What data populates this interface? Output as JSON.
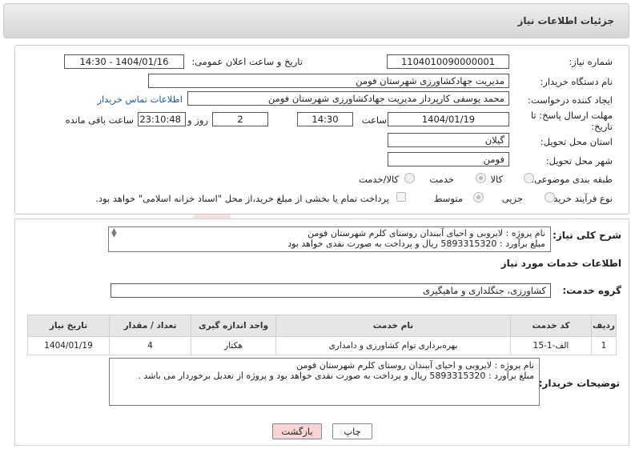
{
  "header": {
    "title": "جزئیات اطلاعات نیاز"
  },
  "form": {
    "need_number": {
      "label": "شماره نیاز:",
      "value": "1104010090000001"
    },
    "announce_datetime": {
      "label": "تاریخ و ساعت اعلان عمومی:",
      "value": "1404/01/16 - 14:30"
    },
    "buyer_org": {
      "label": "نام دستگاه خریدار:",
      "value": "مدیریت جهادکشاورزی شهرستان فومن"
    },
    "requester": {
      "label": "ایجاد کننده درخواست:",
      "value": "محمد یوسفی کارپرداز مدیریت جهادکشاورزی شهرستان فومن",
      "contact_link": "اطلاعات تماس خریدار"
    },
    "deadline": {
      "label": "مهلت ارسال پاسخ: تا تاریخ:",
      "date": "1404/01/19",
      "time_label": "ساعت",
      "time": "14:30",
      "days": "2",
      "days_label": "روز و",
      "remaining": "23:10:48",
      "remaining_label": "ساعت باقی مانده"
    },
    "province": {
      "label": "استان محل تحویل:",
      "value": "گیلان"
    },
    "city": {
      "label": "شهر محل تحویل:",
      "value": "فومن"
    },
    "category": {
      "label": "طبقه بندی موضوعی:",
      "options": [
        "کالا",
        "خدمت",
        "کالا/خدمت"
      ],
      "selected": "خدمت"
    },
    "process": {
      "label": "نوع فرآیند خرید :",
      "options": [
        "جزیی",
        "متوسط"
      ],
      "selected": "متوسط",
      "note": "پرداخت تمام یا بخشی از مبلغ خرید،از محل \"اسناد خزانه اسلامی\" خواهد بود."
    }
  },
  "summary": {
    "label": "شرح کلی نیاز:",
    "line1": "نام پروژه :     لایروبی و احیای آببندان روستای کلرم شهرستان فومن",
    "line2": "مبلغ برآورد :    5893315320 ریال  و پرداخت به صورت نقدی خواهد بود"
  },
  "services": {
    "section_title": "اطلاعات خدمات مورد نیاز",
    "group_label": "گروه خدمت:",
    "group_value": "کشاورزی، جنگلداری و ماهیگیری",
    "columns": [
      "ردیف",
      "کد خدمت",
      "نام خدمت",
      "واحد اندازه گیری",
      "تعداد / مقدار",
      "تاریخ نیاز"
    ],
    "rows": [
      [
        "1",
        "الف-1-15",
        "بهره‌برداری توام کشاورزی و دامداری",
        "هکتار",
        "4",
        "1404/01/19"
      ]
    ]
  },
  "buyer_notes": {
    "label": "توضیحات خریدار:",
    "line1": "نام پروژه :     لایروبی و احیای آببندان روستای کلرم شهرستان فومن",
    "line2": "مبلغ برآورد :    5893315320 ریال  و پرداخت به صورت نقدی خواهد بود و پروژه از تعدیل برخوردار می باشد ."
  },
  "buttons": {
    "print": "چاپ",
    "back": "بازگشت"
  },
  "watermark": "AriaTender.net",
  "colors": {
    "back_button": "#f8d4d4",
    "link": "#1a5ab0",
    "header_bg": "#dedede"
  }
}
